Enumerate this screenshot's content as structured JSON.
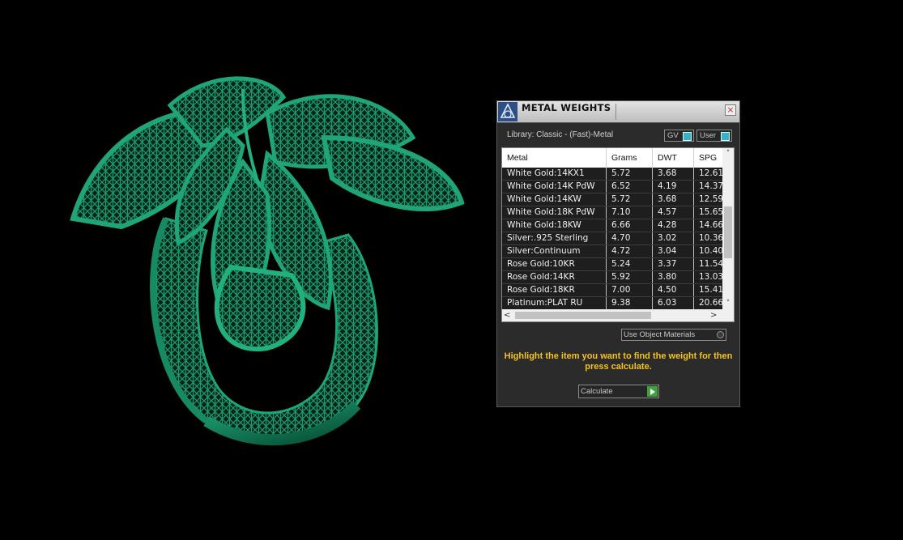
{
  "dialog": {
    "title": "METAL WEIGHTS",
    "close_label": "×",
    "library_label": "Library: Classic - (Fast)-Metal",
    "mode_buttons": {
      "gv": "GV",
      "user": "User"
    },
    "table": {
      "columns": [
        "Metal",
        "Grams",
        "DWT",
        "SPG"
      ],
      "rows": [
        [
          "White Gold:14KX1",
          "5.72",
          "3.68",
          "12.61"
        ],
        [
          "White Gold:14K PdW",
          "6.52",
          "4.19",
          "14.37"
        ],
        [
          "White Gold:14KW",
          "5.72",
          "3.68",
          "12.59"
        ],
        [
          "White Gold:18K PdW",
          "7.10",
          "4.57",
          "15.65"
        ],
        [
          "White Gold:18KW",
          "6.66",
          "4.28",
          "14.66"
        ],
        [
          "Silver:.925 Sterling",
          "4.70",
          "3.02",
          "10.36"
        ],
        [
          "Silver:Continuum",
          "4.72",
          "3.04",
          "10.40"
        ],
        [
          "Rose Gold:10KR",
          "5.24",
          "3.37",
          "11.54"
        ],
        [
          "Rose Gold:14KR",
          "5.92",
          "3.80",
          "13.03"
        ],
        [
          "Rose Gold:18KR",
          "7.00",
          "4.50",
          "15.41"
        ],
        [
          "Platinum:PLAT RU",
          "9.38",
          "6.03",
          "20.66"
        ]
      ]
    },
    "scroll": {
      "up": "˄",
      "down": "˅",
      "left": "<",
      "right": ">"
    },
    "use_object_materials_label": "Use Object Materials",
    "instruction": "Highlight the item you want to find the weight for then press calculate.",
    "calculate_label": "Calculate"
  },
  "colors": {
    "ring_green": "#0f6b4a",
    "instruction_yellow": "#f5c21e",
    "panel_bg": "#2b2b2b"
  }
}
